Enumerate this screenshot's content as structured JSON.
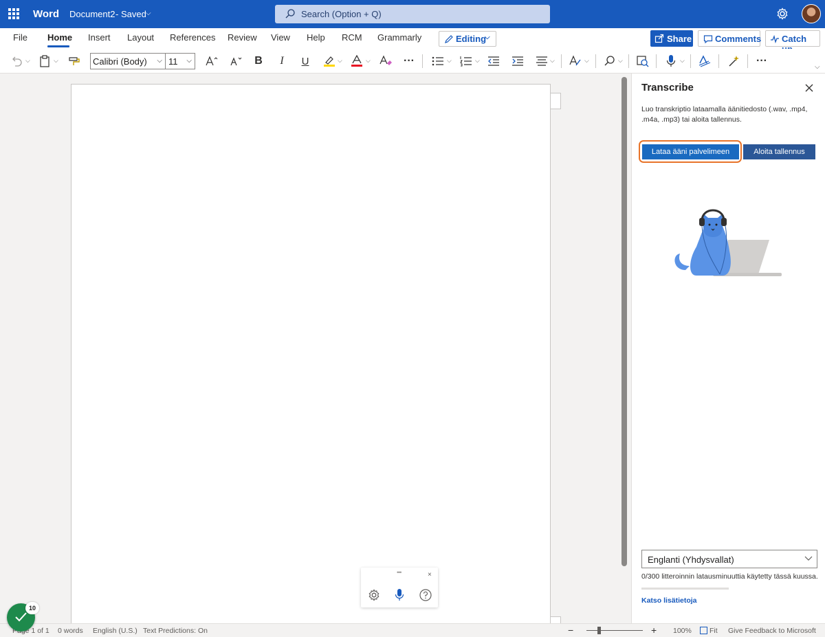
{
  "app": {
    "name": "Word",
    "document_name": "Document2",
    "save_status": "- Saved",
    "search_placeholder": "Search (Option + Q)"
  },
  "menu": {
    "tabs": [
      {
        "label": "File"
      },
      {
        "label": "Home"
      },
      {
        "label": "Insert"
      },
      {
        "label": "Layout"
      },
      {
        "label": "References"
      },
      {
        "label": "Review"
      },
      {
        "label": "View"
      },
      {
        "label": "Help"
      },
      {
        "label": "RCM"
      },
      {
        "label": "Grammarly"
      }
    ],
    "active_tab": "Home",
    "editing_label": "Editing",
    "share_label": "Share",
    "comments_label": "Comments",
    "catchup_label": "Catch up"
  },
  "ribbon": {
    "font_name": "Calibri (Body)",
    "font_size": "11",
    "highlight_color": "#ffd700",
    "font_color": "#e81123"
  },
  "dictation_toolbar": {
    "grip": "•••",
    "close": "×"
  },
  "transcribe_pane": {
    "title": "Transcribe",
    "description": "Luo transkriptio lataamalla äänitiedosto (.wav, .mp4, .m4a, .mp3) tai aloita tallennus.",
    "upload_label": "Lataa ääni palvelimeen",
    "record_label": "Aloita tallennus",
    "language": "Englanti (Yhdysvallat)",
    "usage_text": "0/300 litteroinnin latausminuuttia käytetty tässä kuussa.",
    "usage_fraction": 0,
    "learn_more": "Katso lisätietoja",
    "highlight_color": "#e8742a"
  },
  "status_bar": {
    "page": "Page 1 of 1",
    "words": "0 words",
    "language": "English (U.S.)",
    "predictions": "Text Predictions: On",
    "zoom": "100%",
    "fit": "Fit",
    "feedback": "Give Feedback to Microsoft"
  },
  "badge": {
    "count": "10",
    "color": "#1e8a4c"
  },
  "colors": {
    "brand": "#185abd",
    "title_bar": "#185abd"
  }
}
